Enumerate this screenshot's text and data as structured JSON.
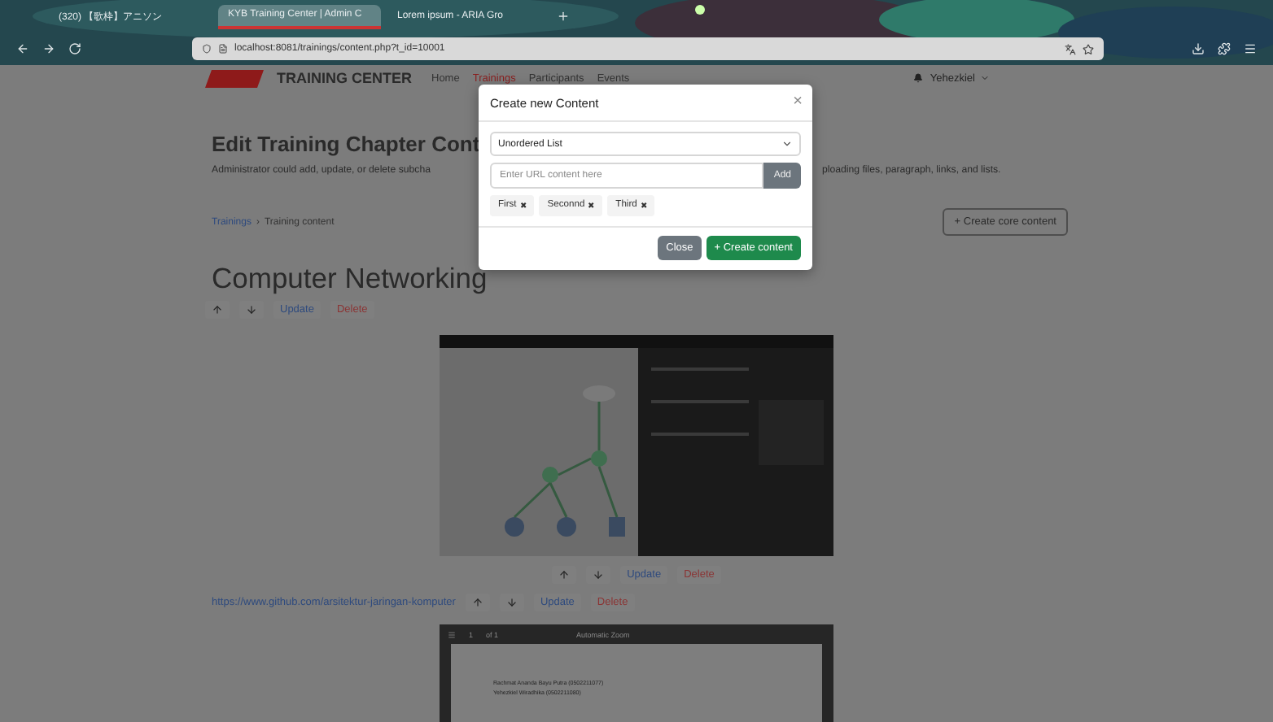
{
  "browser": {
    "tabs": [
      {
        "title": "(320) 【歌枠】アニソン",
        "selected": false
      },
      {
        "title": "KYB Training Center | Admin C",
        "selected": true
      },
      {
        "title": "Lorem ipsum - ARIA Gro",
        "selected": false
      }
    ],
    "address": "localhost:8081/trainings/content.php?t_id=10001"
  },
  "navbar": {
    "brand": "TRAINING CENTER",
    "items": [
      {
        "label": "Home",
        "selected": false
      },
      {
        "label": "Trainings",
        "selected": true
      },
      {
        "label": "Participants",
        "selected": false
      },
      {
        "label": "Events",
        "selected": false
      }
    ],
    "user": "Yehezkiel"
  },
  "page": {
    "title": "Edit Training Chapter Cont",
    "description_left": "Administrator could add, update, or delete subcha",
    "description_right": "ploading files, paragraph, links, and lists.",
    "breadcrumb": [
      "Trainings",
      "›",
      "Training content"
    ],
    "create_button": "+ Create core content",
    "chapter_title": "Computer Networking",
    "actions": {
      "update": "Update",
      "delete": "Delete"
    },
    "contents": [
      {
        "update": "Update",
        "delete": "Delete"
      },
      {
        "kind": "link",
        "url": "https://www.github.com/arsitektur-jaringan-komputer",
        "update": "Update",
        "delete": "Delete"
      },
      {
        "kind": "pdf",
        "page": "1",
        "page_count": "of 1",
        "zoom": "Automatic Zoom",
        "lines": [
          "Rachmat Ananda Bayu Putra (0502211077)",
          "Yehezkiel Wiradhika (0502211080)"
        ]
      }
    ]
  },
  "modal": {
    "title": "Create new Content",
    "close_icon": "×",
    "type": "Unordered List",
    "placeholder": "Enter URL content here",
    "add": "Add",
    "items": [
      "First",
      "Seconnd",
      "Third"
    ],
    "remove": "✖",
    "buttons": {
      "close": "Close",
      "create": "+ Create content"
    }
  }
}
